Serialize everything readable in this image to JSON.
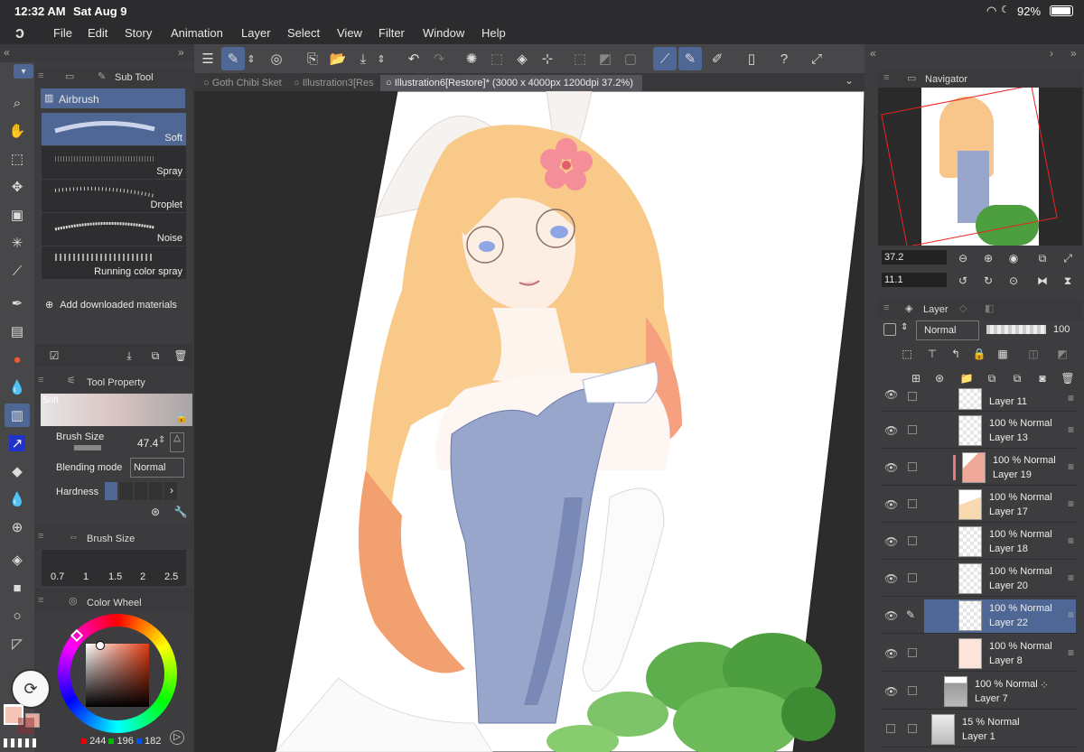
{
  "status": {
    "time": "12:32 AM",
    "date": "Sat Aug 9",
    "battery": "92%"
  },
  "menu": [
    "File",
    "Edit",
    "Story",
    "Animation",
    "Layer",
    "Select",
    "View",
    "Filter",
    "Window",
    "Help"
  ],
  "tabs": [
    "Goth Chibi Sket",
    "Illustration3[Res",
    "Illustration6[Restore]* (3000 x 4000px 1200dpi 37.2%)"
  ],
  "subtool": {
    "title": "Sub Tool",
    "group": "Airbrush",
    "brushes": [
      "Soft",
      "Spray",
      "Droplet",
      "Noise",
      "Running color spray"
    ],
    "add_materials": "Add downloaded materials"
  },
  "toolprop": {
    "title": "Tool Property",
    "preview": "Soft",
    "brush_size_label": "Brush Size",
    "brush_size_value": "47.4",
    "blending_label": "Blending mode",
    "blending_value": "Normal",
    "hardness_label": "Hardness"
  },
  "brushsize": {
    "title": "Brush Size",
    "values": [
      "0.7",
      "1",
      "1.5",
      "2",
      "2.5"
    ]
  },
  "colorwheel": {
    "title": "Color Wheel",
    "r": "244",
    "g": "196",
    "b": "182",
    "main_color": "#f4c4b6"
  },
  "navigator": {
    "title": "Navigator",
    "zoom": "37.2",
    "rotate": "11.1"
  },
  "layerpanel": {
    "title": "Layer",
    "blend": "Normal",
    "opacity": "100"
  },
  "layers": [
    {
      "mode": "",
      "name": "Layer 11",
      "selected": false,
      "thumb": "#f6f6f6"
    },
    {
      "mode": "100 % Normal",
      "name": "Layer 13",
      "selected": false,
      "thumb": "#f6f6f6"
    },
    {
      "mode": "100 % Normal",
      "name": "Layer 19",
      "selected": false,
      "thumb": "#f0a898"
    },
    {
      "mode": "100 % Normal",
      "name": "Layer 17",
      "selected": false,
      "thumb": "#f8d8b0"
    },
    {
      "mode": "100 % Normal",
      "name": "Layer 18",
      "selected": false,
      "thumb": "#f6f6f6"
    },
    {
      "mode": "100 % Normal",
      "name": "Layer 20",
      "selected": false,
      "thumb": "#f6f6f6"
    },
    {
      "mode": "100 % Normal",
      "name": "Layer 22",
      "selected": true,
      "thumb": "#f6f6f6"
    },
    {
      "mode": "100 % Normal",
      "name": "Layer 8",
      "selected": false,
      "thumb": "#fde4d8"
    },
    {
      "mode": "100 % Normal",
      "name": "Layer 7",
      "selected": false,
      "thumb": "#cccccc"
    },
    {
      "mode": "15 % Normal",
      "name": "Layer 1",
      "selected": false,
      "thumb": "#dddddd"
    }
  ]
}
